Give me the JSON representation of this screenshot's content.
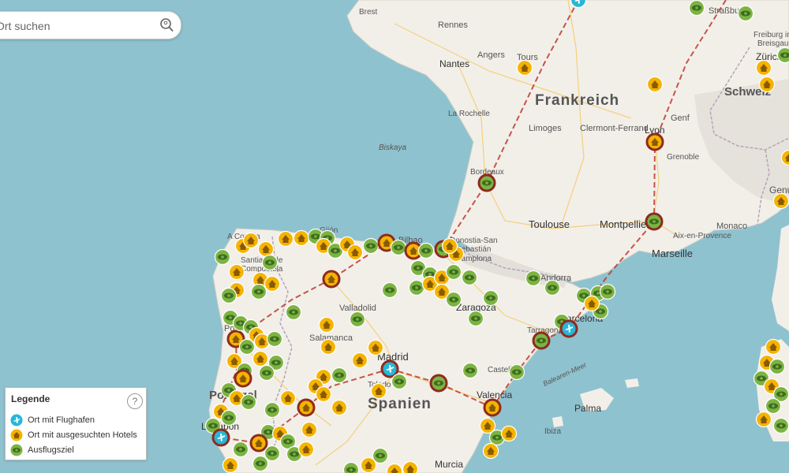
{
  "search": {
    "placeholder": "Ort suchen"
  },
  "legend": {
    "title": "Legende",
    "help": "?",
    "items": [
      {
        "label": "Ort mit Flughafen",
        "icon": "plane-icon"
      },
      {
        "label": "Ort mit ausgesuchten Hotels",
        "icon": "house-icon"
      },
      {
        "label": "Ausflugsziel",
        "icon": "eye-icon"
      }
    ]
  },
  "colors": {
    "sea": "#8fc2cf",
    "land": "#f2efe9",
    "border": "#b7a3b8",
    "route": "#c0392b",
    "hotel": "#f4b400",
    "excursion": "#7cb342",
    "airport": "#29b6d6",
    "ring": "#8d2b1f"
  },
  "map_labels": {
    "countries": [
      "Frankreich",
      "Spanien",
      "Schweiz"
    ],
    "cities": [
      "Brest",
      "Rennes",
      "Nantes",
      "Angers",
      "Tours",
      "La Rochelle",
      "Limoges",
      "Clermont-Ferrand",
      "Lyon",
      "Genf",
      "Grenoble",
      "Bordeaux",
      "Toulouse",
      "Montpellier",
      "Marseille",
      "Aix-en-Provence",
      "Monaco",
      "Straßbur",
      "Freiburg im Breisgau",
      "Zürich",
      "Bilbao",
      "Donostia-San Sebastián",
      "Pamplona",
      "Gijón",
      "A Coruña",
      "Santiago de Compostela",
      "Valladolid",
      "Salamanca",
      "Zaragoza",
      "Andorra",
      "Tarragona",
      "Barcelona",
      "Madrid",
      "Toledo",
      "Valencia",
      "Castellón",
      "Palma",
      "Ibiza",
      "Murcia",
      "Lissabon",
      "Porto",
      "Portugal",
      "Biskaya",
      "Balearen-Meer",
      "Genua"
    ]
  }
}
